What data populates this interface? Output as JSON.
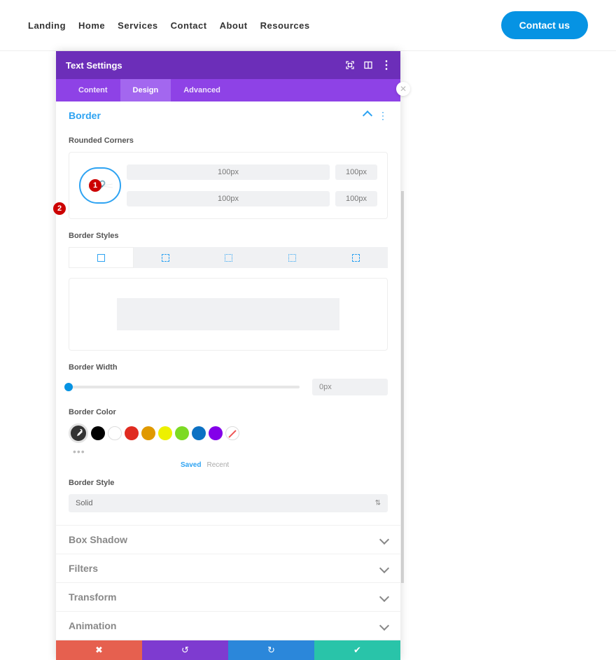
{
  "nav": {
    "items": [
      "Landing",
      "Home",
      "Services",
      "Contact",
      "About",
      "Resources"
    ],
    "cta": "Contact us"
  },
  "annotations": {
    "b1": "1",
    "b2": "2"
  },
  "panel": {
    "title": "Text Settings",
    "tabs": [
      "Content",
      "Design",
      "Advanced"
    ],
    "active_tab": 1,
    "border": {
      "title": "Border",
      "rounded_label": "Rounded Corners",
      "tl": "100px",
      "tr": "100px",
      "bl": "100px",
      "br": "100px",
      "styles_label": "Border Styles",
      "width_label": "Border Width",
      "width_value": "0px",
      "color_label": "Border Color",
      "swatches": [
        "#000000",
        "#ffffff",
        "#e02b20",
        "#e09900",
        "#edf000",
        "#7cda24",
        "#0c71c3",
        "#8300e9"
      ],
      "saved_label": "Saved",
      "recent_label": "Recent",
      "style_label": "Border Style",
      "style_value": "Solid"
    },
    "accordions": [
      "Box Shadow",
      "Filters",
      "Transform",
      "Animation"
    ]
  }
}
